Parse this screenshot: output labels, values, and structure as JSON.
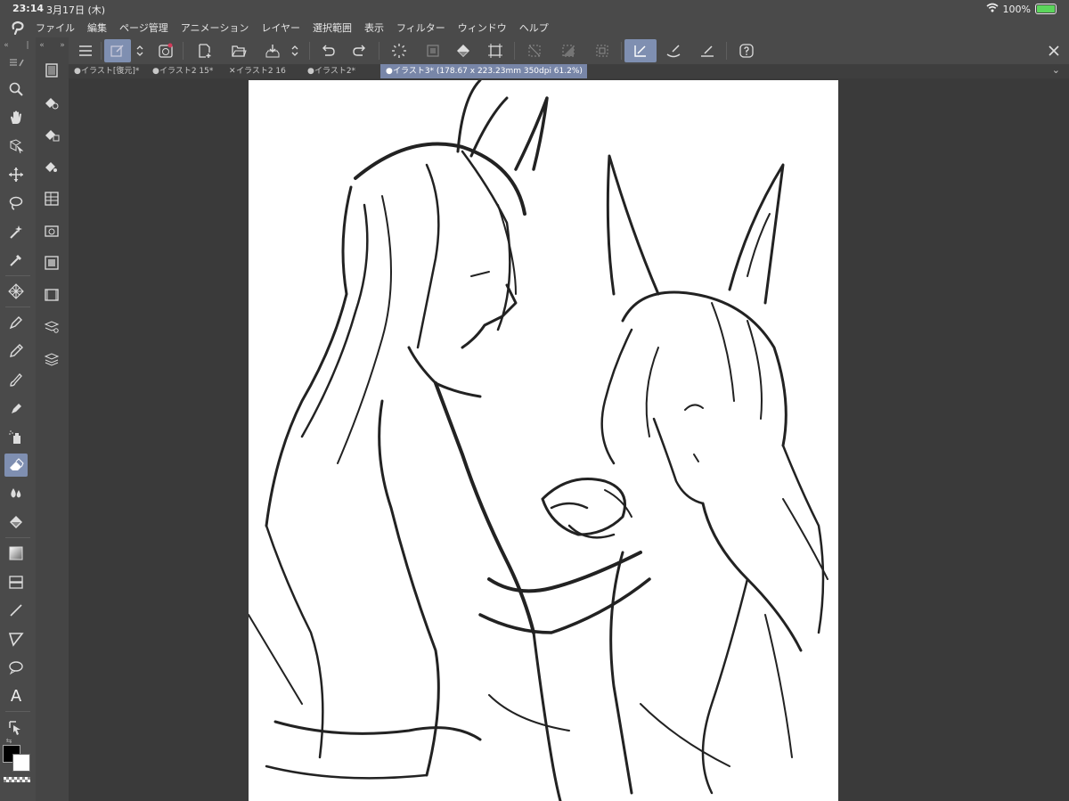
{
  "status": {
    "time": "23:14",
    "date": "3月17日 (木)",
    "battery": "100%"
  },
  "menu": [
    "ファイル",
    "編集",
    "ページ管理",
    "アニメーション",
    "レイヤー",
    "選択範囲",
    "表示",
    "フィルター",
    "ウィンドウ",
    "ヘルプ"
  ],
  "tabs": [
    {
      "label": "イラスト[復元]*",
      "marker": "●"
    },
    {
      "label": "イラスト2 15*",
      "marker": "●"
    },
    {
      "label": "イラスト2 16",
      "marker": "✕"
    },
    {
      "label": "イラスト2*",
      "marker": "●"
    },
    {
      "label": "イラスト3* (178.67 x 223.23mm 350dpi 61.2%)",
      "marker": "●"
    }
  ],
  "active_tab_index": 4,
  "colors": {
    "accent": "#7f8fb1",
    "active_tab": "#7886a8",
    "panel": "#4a4a4a",
    "workspace": "#3a3a3a",
    "foreground": "#000000",
    "background": "#ffffff"
  },
  "icons": {
    "tools": [
      "zoom-icon",
      "hand-icon",
      "object-select-icon",
      "move-icon",
      "lasso-select-icon",
      "magic-wand-icon",
      "eyedropper-icon",
      "mesh-icon",
      "pen-icon",
      "pencil-icon",
      "brush-icon",
      "airbrush-icon",
      "spray-icon",
      "eraser-icon",
      "blend-icon",
      "fill-icon",
      "gradient-icon",
      "figure-icon",
      "line-icon",
      "frame-icon",
      "balloon-icon",
      "text-icon",
      "operation-icon"
    ],
    "sub_tools": [
      "sub-panel-icon",
      "eraser-hard-icon",
      "eraser-soft-icon",
      "eraser-vector-icon",
      "layer-property-icon",
      "camera-icon",
      "material-icon",
      "animation-icon",
      "layer-search-icon",
      "layers-icon"
    ]
  }
}
